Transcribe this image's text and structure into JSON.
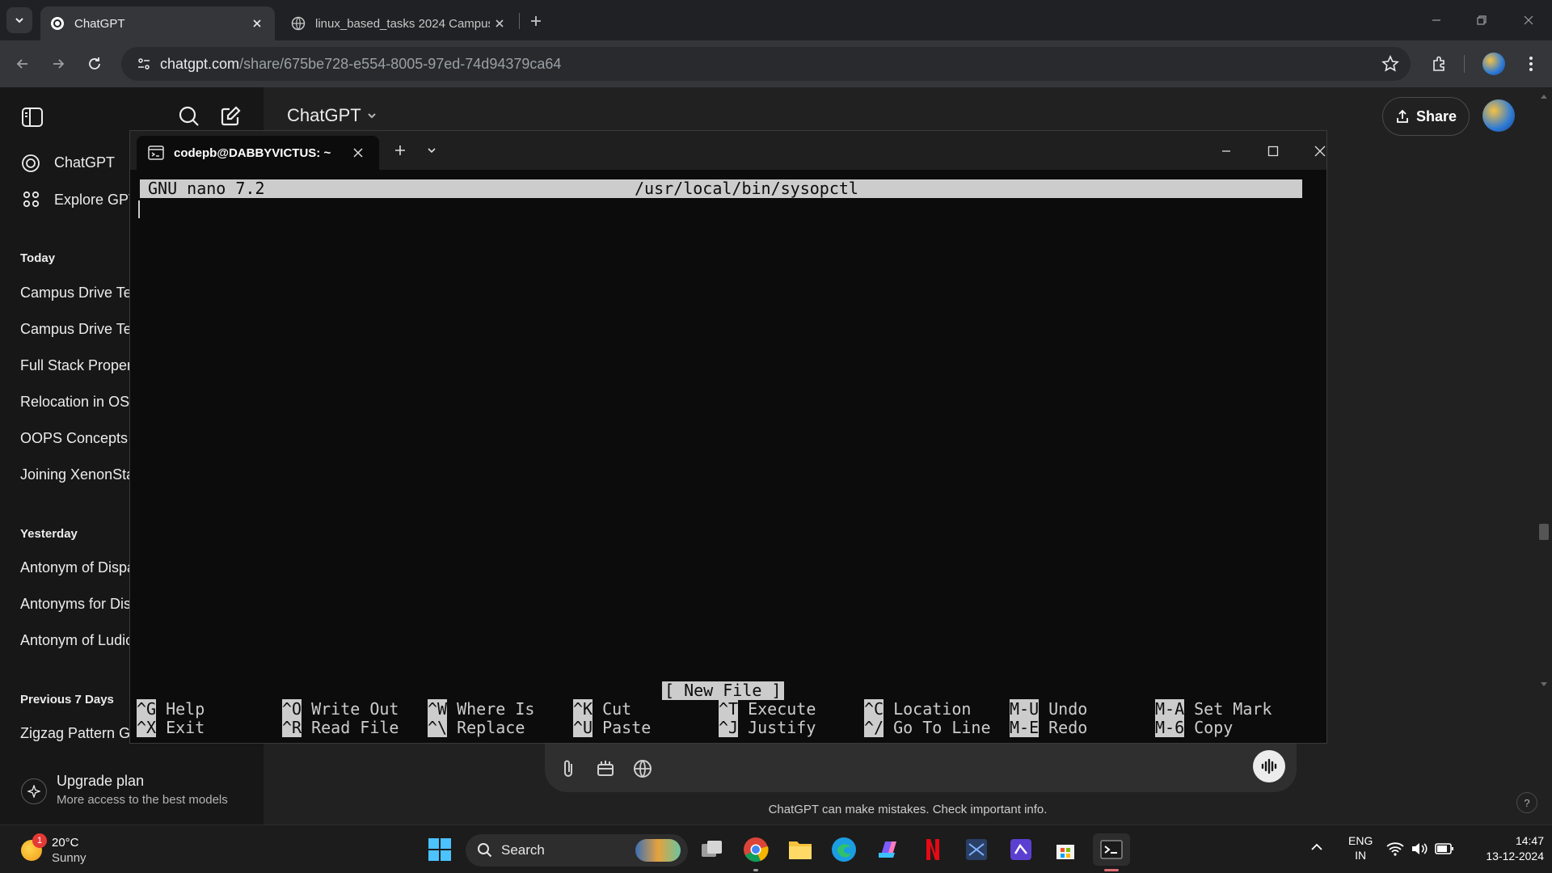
{
  "browser": {
    "tabs": [
      {
        "title": "ChatGPT",
        "active": true
      },
      {
        "title": "linux_based_tasks 2024 Campus",
        "active": false
      }
    ],
    "url_domain": "chatgpt.com",
    "url_path": "/share/675be728-e554-8005-97ed-74d94379ca64"
  },
  "sidebar": {
    "nav": [
      {
        "label": "ChatGPT",
        "icon": "openai-icon"
      },
      {
        "label": "Explore GPTs",
        "icon": "grid-icon"
      }
    ],
    "sections": [
      {
        "title": "Today",
        "items": [
          "Campus Drive Tech",
          "Campus Drive Tech",
          "Full Stack Property",
          "Relocation in OS",
          "OOPS Concepts in",
          "Joining XenonStack"
        ]
      },
      {
        "title": "Yesterday",
        "items": [
          "Antonym of Disparage",
          "Antonyms for Dis",
          "Antonym of Ludicrous"
        ]
      },
      {
        "title": "Previous 7 Days",
        "items": [
          "Zigzag Pattern Generation"
        ]
      }
    ],
    "upgrade": {
      "title": "Upgrade plan",
      "subtitle": "More access to the best models"
    }
  },
  "main": {
    "model_selector": "ChatGPT",
    "share_label": "Share",
    "disclaimer": "ChatGPT can make mistakes. Check important info."
  },
  "terminal": {
    "tab_title": "codepb@DABBYVICTUS: ~",
    "nano_version": "GNU nano 7.2",
    "file_path": "/usr/local/bin/sysopctl",
    "status": "[ New File ]",
    "shortcuts": [
      {
        "key": "^G",
        "label": "Help"
      },
      {
        "key": "^X",
        "label": "Exit"
      },
      {
        "key": "^O",
        "label": "Write Out"
      },
      {
        "key": "^R",
        "label": "Read File"
      },
      {
        "key": "^W",
        "label": "Where Is"
      },
      {
        "key": "^\\",
        "label": "Replace"
      },
      {
        "key": "^K",
        "label": "Cut"
      },
      {
        "key": "^U",
        "label": "Paste"
      },
      {
        "key": "^T",
        "label": "Execute"
      },
      {
        "key": "^J",
        "label": "Justify"
      },
      {
        "key": "^C",
        "label": "Location"
      },
      {
        "key": "^/",
        "label": "Go To Line"
      },
      {
        "key": "M-U",
        "label": "Undo"
      },
      {
        "key": "M-E",
        "label": "Redo"
      },
      {
        "key": "M-A",
        "label": "Set Mark"
      },
      {
        "key": "M-6",
        "label": "Copy"
      }
    ]
  },
  "taskbar": {
    "weather_temp": "20°C",
    "weather_desc": "Sunny",
    "weather_badge": "1",
    "search_label": "Search",
    "lang_1": "ENG",
    "lang_2": "IN",
    "time": "14:47",
    "date": "13-12-2024"
  },
  "colors": {
    "terminal_bg": "#0c0c0c",
    "nano_bar": "#cccccc",
    "page_bg": "#212121",
    "sidebar_bg": "#171717"
  }
}
